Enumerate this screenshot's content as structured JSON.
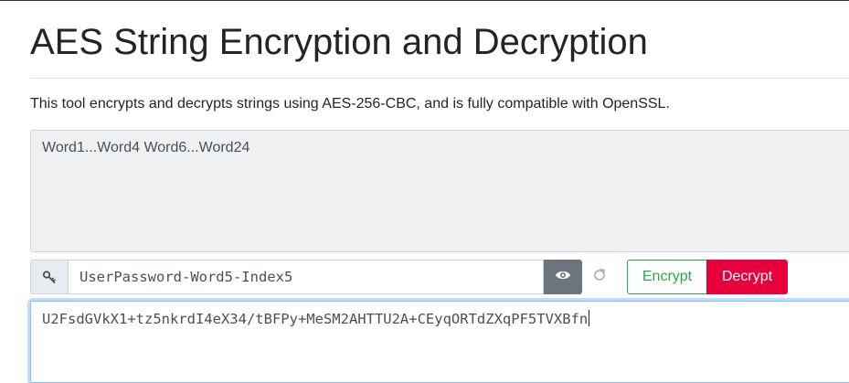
{
  "page": {
    "title": "AES String Encryption and Decryption",
    "description": "This tool encrypts and decrypts strings using AES-256-CBC, and is fully compatible with OpenSSL."
  },
  "plaintext": {
    "value": "Word1...Word4 Word6...Word24"
  },
  "key": {
    "value": "UserPassword-Word5-Index5",
    "key_icon": "key-icon",
    "toggle_icon": "eye-icon",
    "refresh_icon": "refresh-icon"
  },
  "actions": {
    "encrypt_label": "Encrypt",
    "decrypt_label": "Decrypt"
  },
  "ciphertext": {
    "value": "U2FsdGVkX1+tz5nkrdI4eX34/tBFPy+MeSM2AHTTU2A+CEyqORTdZXqPF5TVXBfn"
  },
  "colors": {
    "encrypt": "#28a745",
    "decrypt": "#e8003d",
    "toggle_bg": "#6c757d",
    "focus": "#80bdff"
  }
}
